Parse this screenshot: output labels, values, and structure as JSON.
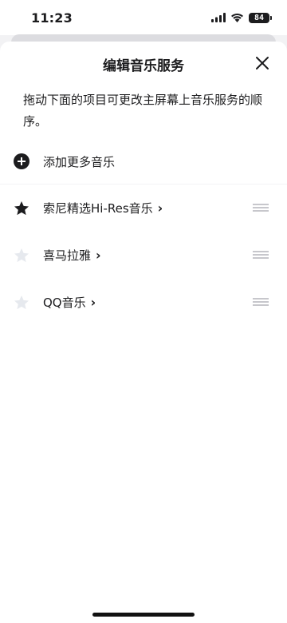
{
  "status_bar": {
    "time": "11:23",
    "battery": "84"
  },
  "sheet": {
    "title": "编辑音乐服务",
    "description": "拖动下面的项目可更改主屏幕上音乐服务的顺序。",
    "add_more_label": "添加更多音乐"
  },
  "services": [
    {
      "label": "索尼精选Hi-Res音乐",
      "chevron": "›",
      "star": "filled"
    },
    {
      "label": "喜马拉雅",
      "chevron": "›",
      "star": "outline"
    },
    {
      "label": "QQ音乐",
      "chevron": "›",
      "star": "outline"
    }
  ],
  "colors": {
    "star_filled": "#1c1c1e",
    "star_empty": "#e6e9ee",
    "handle": "#c7c7cc"
  }
}
